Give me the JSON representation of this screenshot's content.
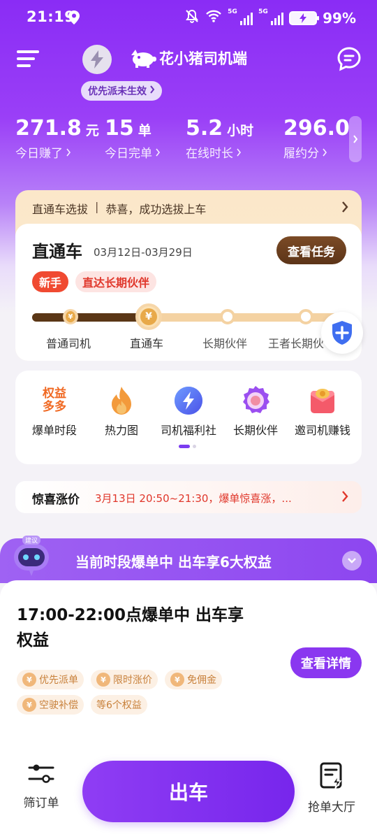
{
  "status_bar": {
    "time": "21:19",
    "battery": "99%",
    "signal1": "5G",
    "signal2": "5G"
  },
  "header": {
    "brand_name": "花小猪司机端",
    "priority_pill": "优先派未生效"
  },
  "stats": [
    {
      "value": "271.8",
      "unit": "元",
      "label": "今日赚了"
    },
    {
      "value": "15",
      "unit": "单",
      "label": "今日完单"
    },
    {
      "value": "5.2",
      "unit": "小时",
      "label": "在线时长"
    },
    {
      "value": "296.0",
      "unit": "",
      "label": "履约分"
    }
  ],
  "train": {
    "banner_left": "直通车选拔",
    "banner_sep": "|",
    "banner_right": "恭喜，成功选拔上车",
    "title": "直通车",
    "date_range": "03月12日-03月29日",
    "task_button": "查看任务",
    "tag_new": "新手",
    "tag_partner": "直达长期伙伴",
    "progress_fraction": 0.37,
    "stages": [
      "普通司机",
      "直通车",
      "长期伙伴",
      "王者长期伙"
    ]
  },
  "functions": [
    {
      "label": "爆单时段",
      "icon": "rights-badge-icon",
      "badge_line1": "权益",
      "badge_line2": "多多"
    },
    {
      "label": "热力图",
      "icon": "flame-icon"
    },
    {
      "label": "司机福利社",
      "icon": "bolt-icon"
    },
    {
      "label": "长期伙伴",
      "icon": "partner-medal-icon"
    },
    {
      "label": "邀司机赚钱",
      "icon": "red-envelope-icon"
    }
  ],
  "surprise": {
    "title": "惊喜涨价",
    "detail": "3月13日 20:50~21:30，爆单惊喜涨，..."
  },
  "promo": {
    "text": "当前时段爆单中 出车享6大权益",
    "robot_tag": "建议"
  },
  "benefit_sheet": {
    "title": "17:00-22:00点爆单中 出车享权益",
    "detail_button": "查看详情",
    "perks": [
      "优先派单",
      "限时涨价",
      "免佣金",
      "空驶补偿"
    ],
    "more_perks": "等6个权益",
    "currency_symbol": "¥"
  },
  "bottom_nav": {
    "filter_label": "筛订单",
    "go_label": "出车",
    "hall_label": "抢单大厅"
  },
  "colors": {
    "brand_purple": "#8a2cf5",
    "accent_red": "#e0372b",
    "gold": "#e8a949",
    "brown": "#5a3616"
  }
}
